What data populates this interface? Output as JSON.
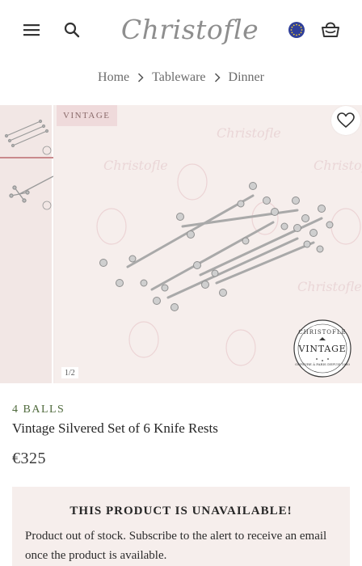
{
  "header": {
    "menu_icon": "menu-icon",
    "search_icon": "search-icon",
    "logo_text": "Christofle",
    "region_icon": "eu-flag-icon",
    "bag_icon": "shopping-bag-icon"
  },
  "breadcrumb": [
    "Home",
    "Tableware",
    "Dinner"
  ],
  "gallery": {
    "badge": "VINTAGE",
    "counter": "1/2",
    "favorite_icon": "heart-icon",
    "stamp": {
      "top_text": "CHRISTOFLE",
      "center_text": "VINTAGE",
      "bottom_text": "ORFÈVRE À PARIS DEPUIS 1830"
    }
  },
  "product": {
    "collection": "4 BALLS",
    "title": "Vintage Silvered Set of 6 Knife Rests",
    "price": "€325"
  },
  "notice": {
    "title": "THIS PRODUCT IS UNAVAILABLE!",
    "text": "Product out of stock. Subscribe to the alert to receive an email once the product is available."
  },
  "colors": {
    "accent_green": "#4f6a3c",
    "panel_bg": "#f6eeec",
    "badge_bg": "#efdadb",
    "thumb_active": "#c98a8c"
  }
}
